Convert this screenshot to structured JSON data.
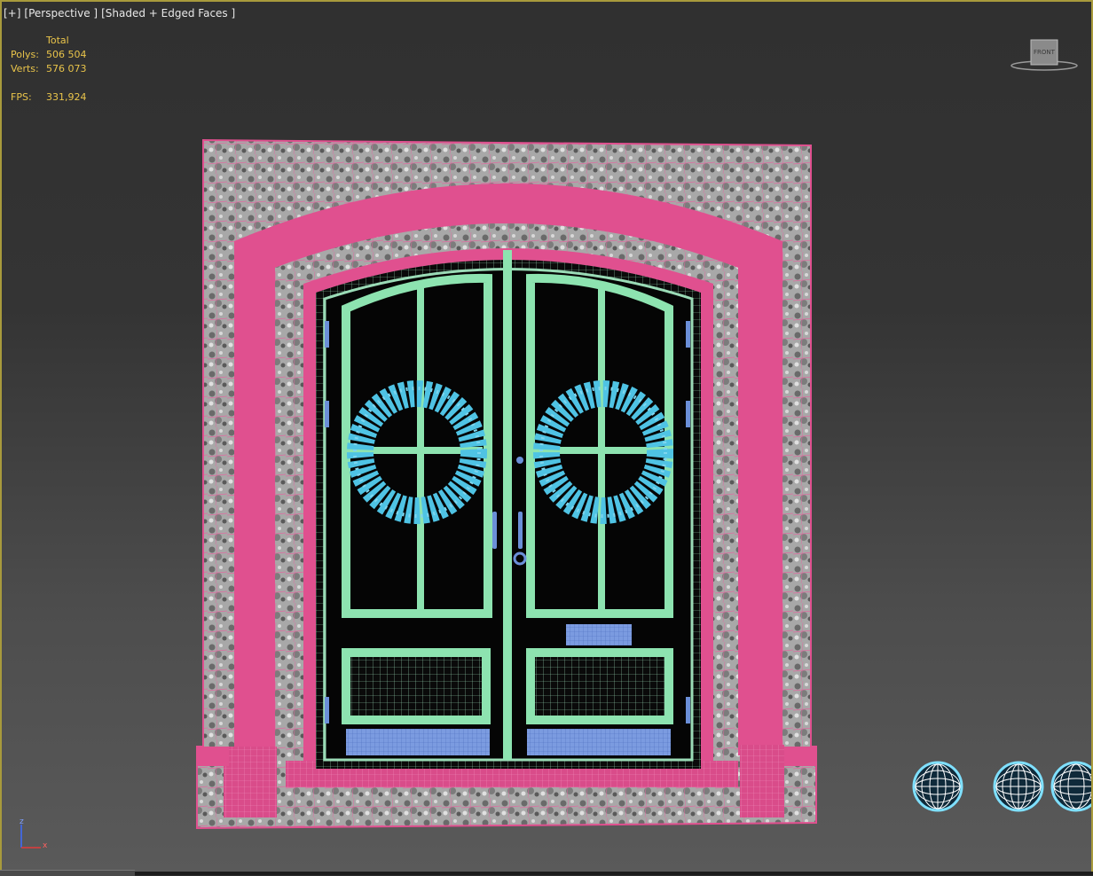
{
  "viewport": {
    "labels": [
      "[+]",
      "[Perspective ]",
      "[Shaded + Edged Faces ]"
    ],
    "stats": {
      "header": "Total",
      "rows": [
        {
          "key": "Polys:",
          "value": "506 504"
        },
        {
          "key": "Verts:",
          "value": "576 073"
        }
      ],
      "fps_key": "FPS:",
      "fps_value": "331,924"
    },
    "viewcube_label": "FRONT",
    "axis": {
      "z": "z",
      "x": "x"
    }
  },
  "colors": {
    "frame_pink": "#e0508f",
    "stone_gray": "#a9a9a9",
    "door_green": "#8de3b0",
    "wreath_cyan": "#4fc3e4",
    "hardware_blue": "#6b8fd8",
    "stats_yellow": "#e9c44a",
    "viewport_border": "#a89a3c"
  },
  "material_spheres": [
    {
      "name": "material-sphere-1"
    },
    {
      "name": "material-sphere-2"
    },
    {
      "name": "material-sphere-3"
    }
  ]
}
